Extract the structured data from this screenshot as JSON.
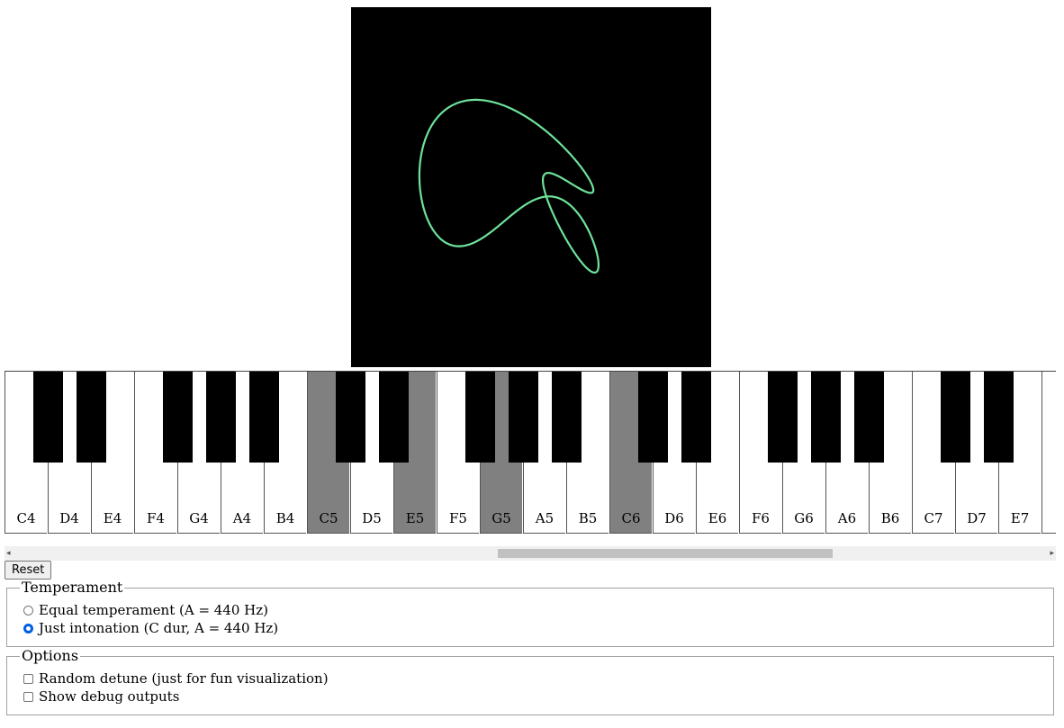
{
  "visualizer": {
    "background": "#000000",
    "trace_color": "#6ee29a"
  },
  "keyboard": {
    "white_keys": [
      "C4",
      "D4",
      "E4",
      "F4",
      "G4",
      "A4",
      "B4",
      "C5",
      "D5",
      "E5",
      "F5",
      "G5",
      "A5",
      "B5",
      "C6",
      "D6",
      "E6",
      "F6",
      "G6",
      "A6",
      "B6",
      "C7",
      "D7",
      "E7",
      ""
    ],
    "active_keys": [
      "C5",
      "E5",
      "G5",
      "C6"
    ],
    "active_color": "#808080"
  },
  "controls": {
    "reset_label": "Reset"
  },
  "temperament": {
    "legend": "Temperament",
    "options": [
      {
        "label": "Equal temperament (A = 440 Hz)",
        "checked": false
      },
      {
        "label": "Just intonation (C dur, A = 440 Hz)",
        "checked": true
      }
    ]
  },
  "options": {
    "legend": "Options",
    "items": [
      {
        "label": "Random detune (just for fun visualization)",
        "checked": false
      },
      {
        "label": "Show debug outputs",
        "checked": false
      }
    ]
  },
  "scrollbar": {
    "left_arrow": "◂",
    "right_arrow": "▸"
  }
}
